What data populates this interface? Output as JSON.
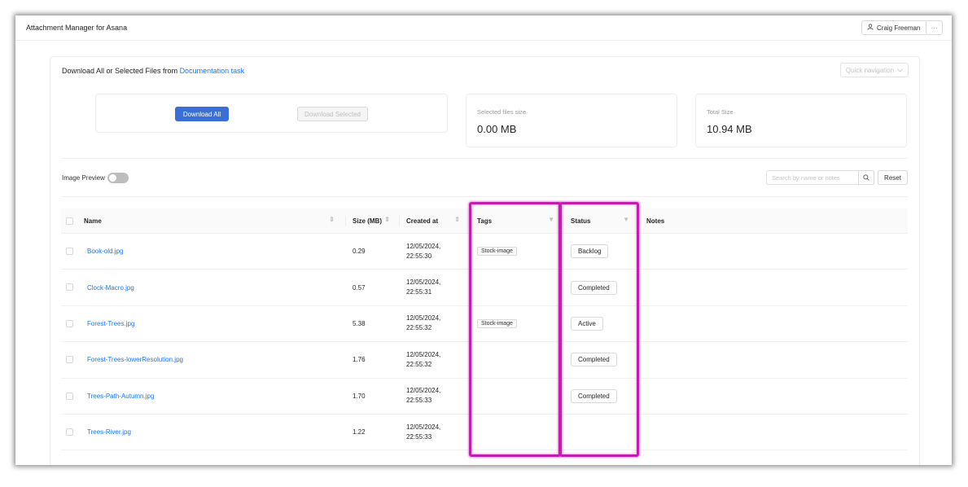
{
  "app": {
    "title": "Attachment Manager for Asana",
    "user_name": "Craig Freeman",
    "more_label": "···"
  },
  "header": {
    "title_prefix": "Download All or Selected Files from ",
    "task_link": "Documentation task",
    "quick_nav": "Quick navigation"
  },
  "actions": {
    "download_all": "Download All",
    "download_selected": "Download Selected"
  },
  "stats": {
    "selected_label": "Selected files size",
    "selected_value": "0.00 MB",
    "total_label": "Total Size",
    "total_value": "10.94 MB"
  },
  "toolbar": {
    "image_preview_label": "Image Preview",
    "image_preview_on": false,
    "search_placeholder": "Search by name or notes",
    "reset_label": "Reset"
  },
  "table": {
    "columns": {
      "name": "Name",
      "size": "Size (MB)",
      "created": "Created at",
      "tags": "Tags",
      "status": "Status",
      "notes": "Notes"
    },
    "rows": [
      {
        "name": "Book-old.jpg",
        "size": "0.29",
        "date": "12/05/2024,",
        "time": "22:55:30",
        "tag": "Stock-image",
        "status": "Backlog"
      },
      {
        "name": "Clock-Macro.jpg",
        "size": "0.57",
        "date": "12/05/2024,",
        "time": "22:55:31",
        "tag": "",
        "status": "Completed"
      },
      {
        "name": "Forest-Trees.jpg",
        "size": "5.38",
        "date": "12/05/2024,",
        "time": "22:55:32",
        "tag": "Stock-image",
        "status": "Active"
      },
      {
        "name": "Forest-Trees-lowerResolution.jpg",
        "size": "1.76",
        "date": "12/05/2024,",
        "time": "22:55:32",
        "tag": "",
        "status": "Completed"
      },
      {
        "name": "Trees-Path-Autumn.jpg",
        "size": "1.70",
        "date": "12/05/2024,",
        "time": "22:55:33",
        "tag": "",
        "status": "Completed"
      },
      {
        "name": "Trees-River.jpg",
        "size": "1.22",
        "date": "12/05/2024,",
        "time": "22:55:33",
        "tag": "",
        "status": ""
      }
    ]
  },
  "colors": {
    "primary": "#3a6fd8",
    "link": "#1677ff",
    "highlight": "#c21fae"
  }
}
